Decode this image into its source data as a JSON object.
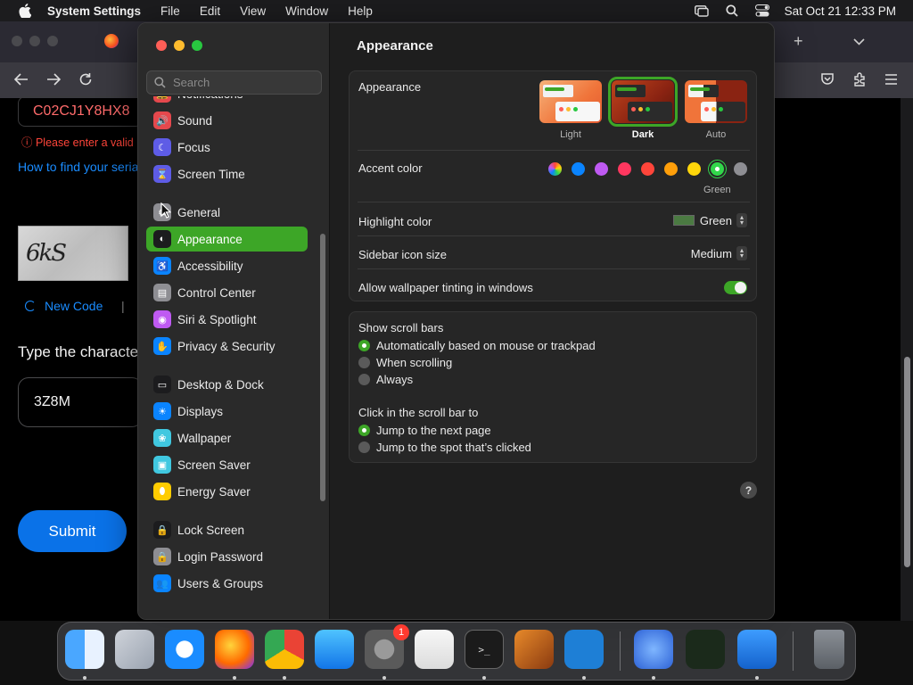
{
  "menubar": {
    "app_name": "System Settings",
    "menus": [
      "File",
      "Edit",
      "View",
      "Window",
      "Help"
    ],
    "clock": "Sat Oct 21  12:33 PM"
  },
  "browser_page": {
    "serial_value": "C02CJ1Y8HX8",
    "error": "ⓘ Please enter a valid",
    "link": "How to find your seria",
    "captcha_text": "6kS",
    "new_code": "New Code",
    "separator": "|",
    "type_prompt": "Type the characte",
    "code_value": "3Z8M",
    "submit": "Submit"
  },
  "settings": {
    "search_placeholder": "Search",
    "sidebar_items": [
      {
        "label": "Notifications",
        "icon": "bell-icon",
        "color": "#e5484d"
      },
      {
        "label": "Sound",
        "icon": "speaker-icon",
        "color": "#e5484d"
      },
      {
        "label": "Focus",
        "icon": "moon-icon",
        "color": "#5e5ce6"
      },
      {
        "label": "Screen Time",
        "icon": "hourglass-icon",
        "color": "#5e5ce6"
      },
      {
        "label": "General",
        "icon": "gear-icon",
        "color": "#8e8e93"
      },
      {
        "label": "Appearance",
        "icon": "appearance-icon",
        "color": "#1c1c1e"
      },
      {
        "label": "Accessibility",
        "icon": "accessibility-icon",
        "color": "#0a84ff"
      },
      {
        "label": "Control Center",
        "icon": "control-center-icon",
        "color": "#8e8e93"
      },
      {
        "label": "Siri & Spotlight",
        "icon": "siri-icon",
        "color": "#bf5af2"
      },
      {
        "label": "Privacy & Security",
        "icon": "hand-icon",
        "color": "#0a84ff"
      },
      {
        "label": "Desktop & Dock",
        "icon": "dock-icon",
        "color": "#1c1c1e"
      },
      {
        "label": "Displays",
        "icon": "sun-icon",
        "color": "#0a84ff"
      },
      {
        "label": "Wallpaper",
        "icon": "flower-icon",
        "color": "#40c8e0"
      },
      {
        "label": "Screen Saver",
        "icon": "screen-saver-icon",
        "color": "#40c8e0"
      },
      {
        "label": "Energy Saver",
        "icon": "lightbulb-icon",
        "color": "#ffcc00"
      },
      {
        "label": "Lock Screen",
        "icon": "lock-icon",
        "color": "#1c1c1e"
      },
      {
        "label": "Login Password",
        "icon": "padlock-icon",
        "color": "#8e8e93"
      },
      {
        "label": "Users & Groups",
        "icon": "users-icon",
        "color": "#0a84ff"
      }
    ],
    "selected_item": "Appearance",
    "title": "Appearance",
    "appearance": {
      "label": "Appearance",
      "options": [
        "Light",
        "Dark",
        "Auto"
      ],
      "selected": "Dark"
    },
    "accent": {
      "label": "Accent color",
      "colors": [
        "multicolor",
        "#0a84ff",
        "#bf5af2",
        "#ff375f",
        "#ff453a",
        "#ff9f0a",
        "#ffd60a",
        "#32d74b",
        "#8e8e93"
      ],
      "selected_name": "Green"
    },
    "highlight": {
      "label": "Highlight color",
      "value": "Green",
      "swatch": "#4b7a42"
    },
    "sidebar_icon_size": {
      "label": "Sidebar icon size",
      "value": "Medium"
    },
    "wallpaper_tinting": {
      "label": "Allow wallpaper tinting in windows",
      "on": true
    },
    "scroll_bars": {
      "label": "Show scroll bars",
      "options": [
        "Automatically based on mouse or trackpad",
        "When scrolling",
        "Always"
      ],
      "selected": 0
    },
    "scroll_click": {
      "label": "Click in the scroll bar to",
      "options": [
        "Jump to the next page",
        "Jump to the spot that’s clicked"
      ],
      "selected": 0
    },
    "help": "?"
  },
  "dock": {
    "apps": [
      "Finder",
      "Launchpad",
      "Safari",
      "Firefox",
      "Chrome",
      "App Store",
      "System Settings",
      "TextEdit",
      "Terminal",
      "GarageBand",
      "Visual Studio Code",
      "Widgets",
      "Activity Monitor",
      "Keynote",
      "Trash"
    ],
    "settings_badge": "1"
  },
  "colors": {
    "accent": "#3da627",
    "link": "#1a8cff",
    "error": "#ff453a",
    "submit": "#0a72e8"
  }
}
